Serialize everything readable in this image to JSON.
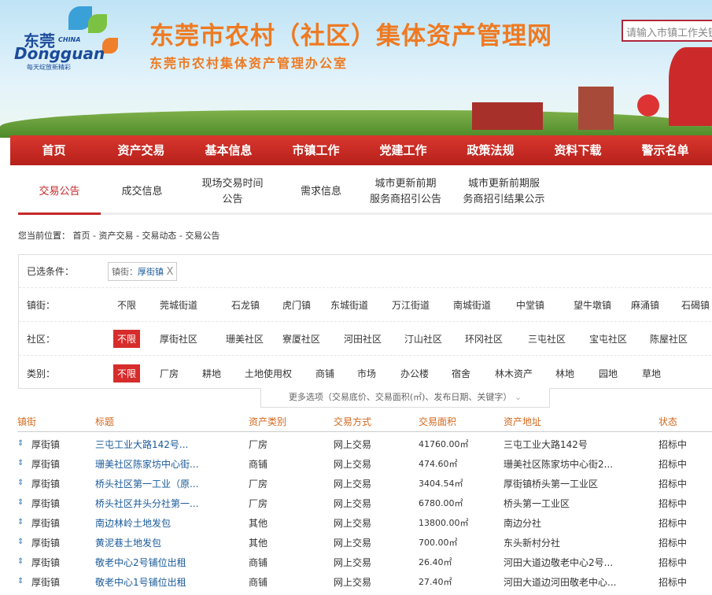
{
  "header": {
    "logo_cn": "东莞",
    "logo_china": "CHINA",
    "logo_en": "Dongguan",
    "logo_slogan": "每天绽放新精彩",
    "title": "东莞市农村（社区）集体资产管理网",
    "subtitle": "东莞市农村集体资产管理办公室",
    "search_placeholder": "请输入市镇工作关键字"
  },
  "nav": [
    "首页",
    "资产交易",
    "基本信息",
    "市镇工作",
    "党建工作",
    "政策法规",
    "资料下载",
    "警示名单"
  ],
  "tabs": [
    "交易公告",
    "成交信息",
    "现场交易时间\n公告",
    "需求信息",
    "城市更新前期\n服务商招引公告",
    "城市更新前期服\n务商招引结果公示"
  ],
  "breadcrumb": "您当前位置： 首页 - 资产交易 - 交易动态 - 交易公告",
  "filter": {
    "selected_label": "已选条件：",
    "chip_key": "镇街：",
    "chip_value": "厚街镇",
    "chip_close": "X",
    "town_label": "镇街：",
    "towns": [
      "不限",
      "莞城街道",
      "石龙镇",
      "虎门镇",
      "东城街道",
      "万江街道",
      "南城街道",
      "中堂镇",
      "望牛墩镇",
      "麻涌镇",
      "石碣镇"
    ],
    "community_label": "社区：",
    "communities": [
      "不限",
      "厚街社区",
      "珊美社区",
      "寮厦社区",
      "河田社区",
      "汀山社区",
      "环冈社区",
      "三屯社区",
      "宝屯社区",
      "陈屋社区"
    ],
    "category_label": "类别：",
    "categories": [
      "不限",
      "厂房",
      "耕地",
      "土地使用权",
      "商铺",
      "市场",
      "办公楼",
      "宿舍",
      "林木资产",
      "林地",
      "园地",
      "草地"
    ],
    "more": "更多选项（交易底价、交易面积(㎡)、发布日期、关键字）",
    "more_icon": "chevron-down"
  },
  "table": {
    "headers": [
      "镇街",
      "标题",
      "资产类别",
      "交易方式",
      "交易面积",
      "资产地址",
      "状态"
    ],
    "rows": [
      [
        "厚街镇",
        "三屯工业大路142号...",
        "厂房",
        "网上交易",
        "41760.00㎡",
        "三屯工业大路142号",
        "招标中"
      ],
      [
        "厚街镇",
        "珊美社区陈家坊中心街...",
        "商铺",
        "网上交易",
        "474.60㎡",
        "珊美社区陈家坊中心街2...",
        "招标中"
      ],
      [
        "厚街镇",
        "桥头社区第一工业（原...",
        "厂房",
        "网上交易",
        "3404.54㎡",
        "厚街镇桥头第一工业区",
        "招标中"
      ],
      [
        "厚街镇",
        "桥头社区井头分社第一...",
        "厂房",
        "网上交易",
        "6780.00㎡",
        "桥头第一工业区",
        "招标中"
      ],
      [
        "厚街镇",
        "南边林岭土地发包",
        "其他",
        "网上交易",
        "13800.00㎡",
        "南边分社",
        "招标中"
      ],
      [
        "厚街镇",
        "黄泥巷土地发包",
        "其他",
        "网上交易",
        "700.00㎡",
        "东头新村分社",
        "招标中"
      ],
      [
        "厚街镇",
        "敬老中心2号铺位出租",
        "商铺",
        "网上交易",
        "26.40㎡",
        "河田大道边敬老中心2号...",
        "招标中"
      ],
      [
        "厚街镇",
        "敬老中心1号铺位出租",
        "商铺",
        "网上交易",
        "27.40㎡",
        "河田大道边河田敬老中心...",
        "招标中"
      ]
    ]
  }
}
